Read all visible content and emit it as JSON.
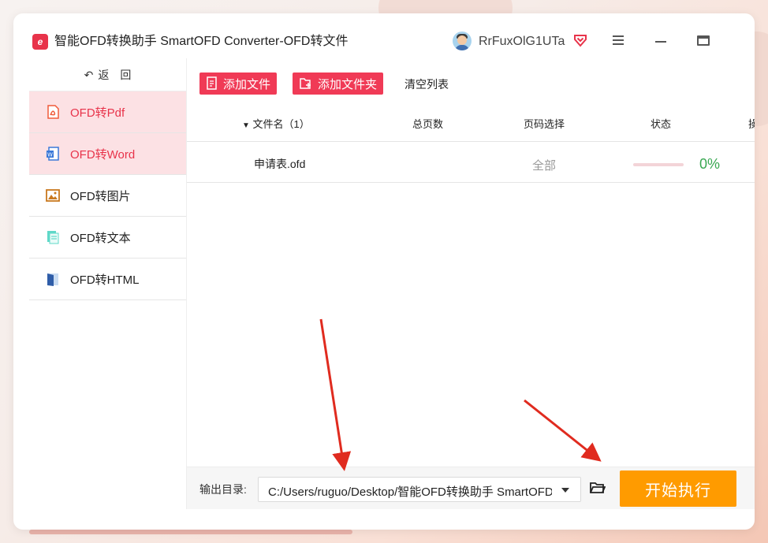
{
  "app": {
    "title": "智能OFD转换助手 SmartOFD Converter-OFD转文件",
    "logo_text": "e"
  },
  "user": {
    "name": "RrFuxOlG1UTa"
  },
  "sidebar": {
    "back_label": "返　回",
    "items": [
      {
        "label": "OFD转Pdf",
        "icon": "pdf-icon",
        "active": true
      },
      {
        "label": "OFD转Word",
        "icon": "word-icon",
        "active": true
      },
      {
        "label": "OFD转图片",
        "icon": "image-icon",
        "active": false
      },
      {
        "label": "OFD转文本",
        "icon": "text-icon",
        "active": false
      },
      {
        "label": "OFD转HTML",
        "icon": "html-icon",
        "active": false
      }
    ]
  },
  "toolbar": {
    "add_file": "添加文件",
    "add_folder": "添加文件夹",
    "clear_list": "清空列表"
  },
  "table": {
    "columns": [
      "文件名（1）",
      "总页数",
      "页码选择",
      "状态",
      "操"
    ],
    "rows": [
      {
        "filename": "申请表.ofd",
        "total_pages": "",
        "page_select": "全部",
        "progress": 0,
        "status": "0%"
      }
    ]
  },
  "footer": {
    "output_label": "输出目录:",
    "output_path": "C:/Users/ruguo/Desktop/智能OFD转换助手 SmartOFD",
    "start_button": "开始执行"
  },
  "colors": {
    "accent": "#e8334a",
    "start_button": "#ff9b00",
    "active_bg": "#fce1e4",
    "percent": "#39a852"
  }
}
